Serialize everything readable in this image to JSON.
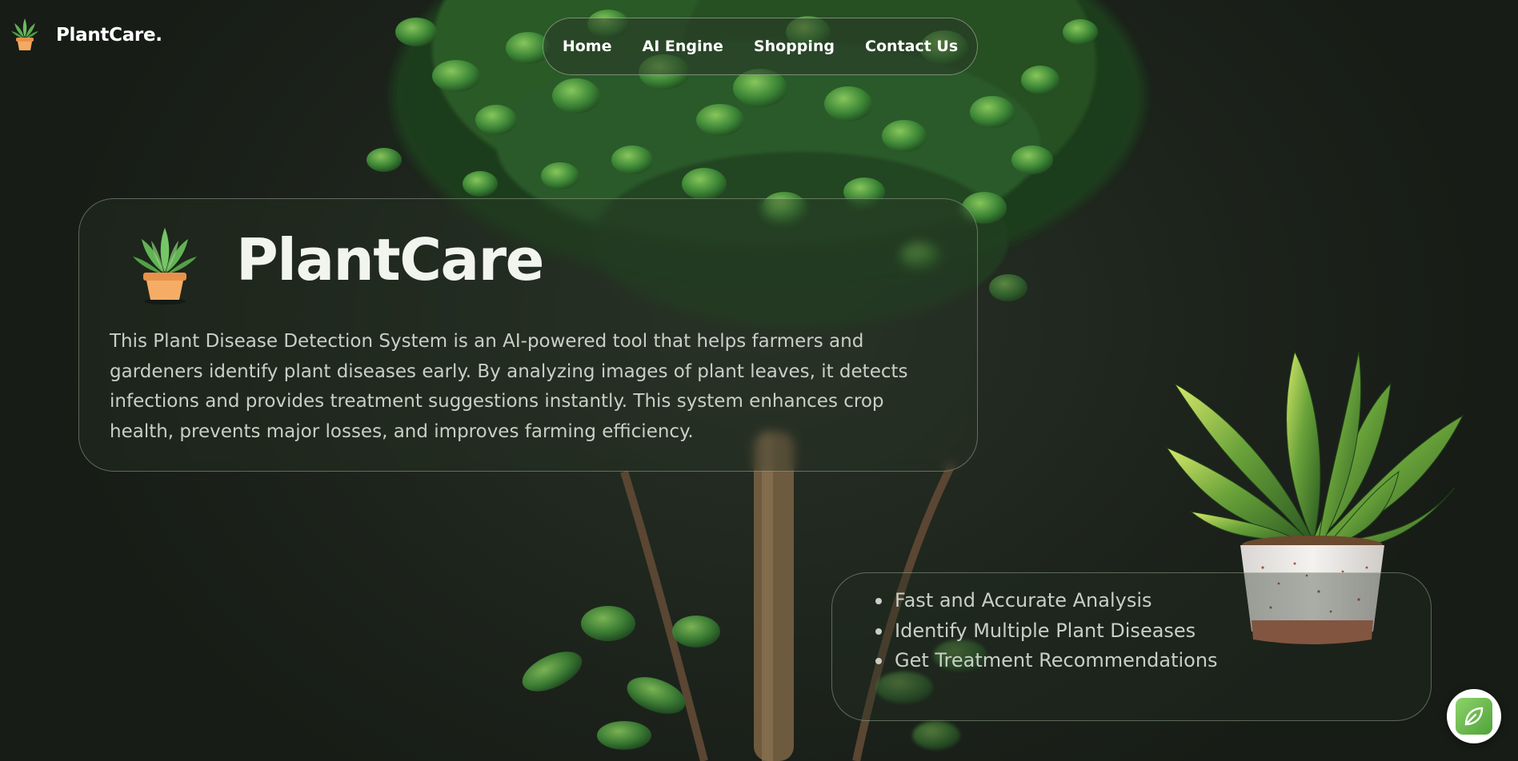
{
  "header": {
    "brand_name": "PlantCare.",
    "nav": [
      {
        "label": "Home"
      },
      {
        "label": "AI Engine"
      },
      {
        "label": "Shopping"
      },
      {
        "label": "Contact Us"
      }
    ]
  },
  "hero": {
    "title": "PlantCare",
    "description": "This Plant Disease Detection System is an AI-powered tool that helps farmers and gardeners identify plant diseases early. By analyzing images of plant leaves, it detects infections and provides treatment suggestions instantly. This system enhances crop health, prevents major losses, and improves farming efficiency."
  },
  "features": {
    "items": [
      "Fast and Accurate Analysis",
      "Identify Multiple Plant Diseases",
      "Get Treatment Recommendations"
    ]
  },
  "icons": {
    "brand_logo": "potted-plant-icon",
    "hero_logo": "potted-plant-icon",
    "chat_button": "leaf-icon"
  },
  "colors": {
    "background": "#1d231d",
    "leaf_green": "#5cb85c",
    "pot_orange": "#f0a25a",
    "text_light": "#eef3ea",
    "text_muted": "#c9cfc6"
  }
}
